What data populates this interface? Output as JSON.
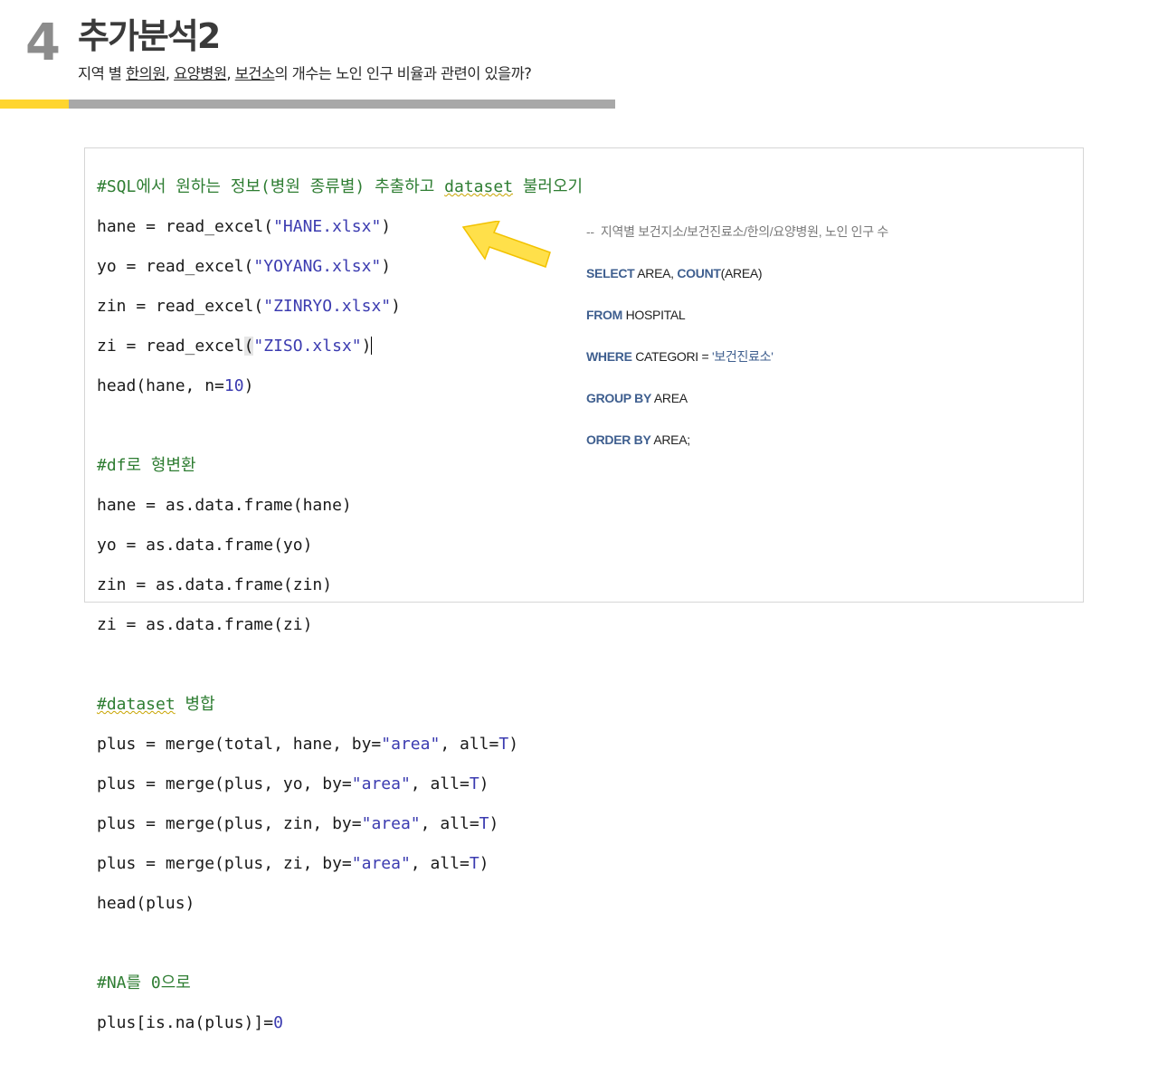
{
  "header": {
    "section_number": "4",
    "title": "추가분석2",
    "subtitle": {
      "prefix": "지역 별 ",
      "u1": "한의원",
      "sep1": ", ",
      "u2": "요양병원",
      "sep2": ", ",
      "u3": "보건소",
      "suffix": "의 개수는 노인 인구 비율과 관련이 있을까?"
    }
  },
  "colors": {
    "accent_yellow": "#ffd52e",
    "bar_gray": "#a8a8a8",
    "comment_green": "#2e7d32",
    "string_blue": "#3b3bb0",
    "sql_keyword": "#3f5f8f",
    "arrow_yellow": "#ffe04a"
  },
  "code": {
    "c1": "#SQL에서 원하는 정보(병원 종류별) 추출하고 ",
    "c1_word": "dataset",
    "c1_end": " 불러오기",
    "l1a": "hane = read_excel(",
    "l1s": "\"HANE.xlsx\"",
    "l1b": ")",
    "l2a": "yo = read_excel(",
    "l2s": "\"YOYANG.xlsx\"",
    "l2b": ")",
    "l3a": "zin = read_excel(",
    "l3s": "\"ZINRYO.xlsx\"",
    "l3b": ")",
    "l4a": "zi = read_excel",
    "l4p": "(",
    "l4s": "\"ZISO.xlsx\"",
    "l4b": ")",
    "l5a": "head(hane, n=",
    "l5n": "10",
    "l5b": ")",
    "c2": "#df로 형변환",
    "l6": "hane = as.data.frame(hane)",
    "l7": "yo = as.data.frame(yo)",
    "l8": "zin = as.data.frame(zin)",
    "l9": "zi = as.data.frame(zi)",
    "c3_word": "#dataset",
    "c3_end": " 병합",
    "m1a": "plus = merge(total, hane, by=",
    "m1s": "\"area\"",
    "m1b": ", all=",
    "m1k": "T",
    "m1c": ")",
    "m2a": "plus = merge(plus, yo, by=",
    "m2s": "\"area\"",
    "m2b": ", all=",
    "m2k": "T",
    "m2c": ")",
    "m3a": "plus = merge(plus, zin, by=",
    "m3s": "\"area\"",
    "m3b": ", all=",
    "m3k": "T",
    "m3c": ")",
    "m4a": "plus = merge(plus, zi, by=",
    "m4s": "\"area\"",
    "m4b": ", all=",
    "m4k": "T",
    "m4c": ")",
    "l10": "head(plus)",
    "c4": "#NA를 0으로",
    "l11a": "plus[is.na(plus)]=",
    "l11n": "0"
  },
  "sql": {
    "comment": "--  지역별 보건지소/보건진료소/한의/요양병원, 노인 인구 수",
    "select_kw": "SELECT",
    "select_rest1": " AREA, ",
    "count_kw": "COUNT",
    "select_rest2": "(AREA)",
    "from_kw": "FROM",
    "from_rest": " HOSPITAL",
    "where_kw": "WHERE",
    "where_rest": " CATEGORI = ",
    "where_str": "'보건진료소'",
    "group_kw": "GROUP BY",
    "group_rest": " AREA",
    "order_kw": "ORDER BY",
    "order_rest": " AREA;"
  }
}
